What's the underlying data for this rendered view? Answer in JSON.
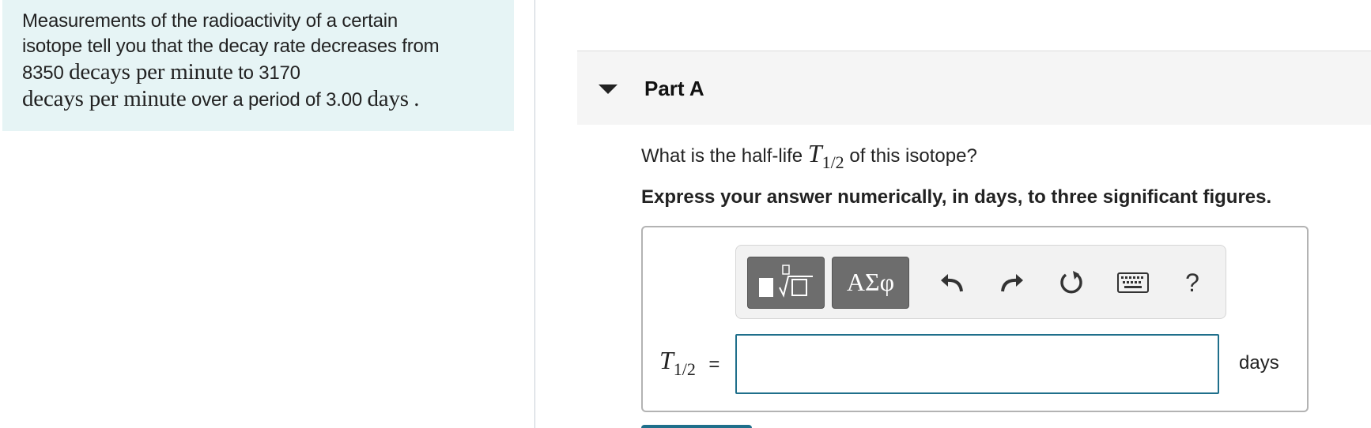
{
  "problem": {
    "line1": "Measurements of the radioactivity of a certain",
    "line2": "isotope tell you that the decay rate decreases from",
    "rate_start_value": "8350",
    "rate_units": "decays per minute",
    "connector_to": "to",
    "rate_end_value": "3170",
    "period_text": "over a period of 3.00",
    "period_units": "days",
    "end_punct": "."
  },
  "part": {
    "title": "Part A"
  },
  "question": {
    "prefix": "What is the half-life",
    "symbol": "T",
    "subscript": "1/2",
    "suffix": "of this isotope?",
    "instruction": "Express your answer numerically, in days, to three significant figures."
  },
  "toolbar": {
    "symbols_label": "ΑΣφ",
    "help_label": "?",
    "icons": [
      "templates-icon",
      "greek-symbols-icon",
      "undo-icon",
      "redo-icon",
      "reset-icon",
      "keyboard-icon",
      "help-icon"
    ]
  },
  "answer": {
    "lhs_symbol": "T",
    "lhs_subscript": "1/2",
    "equals": "=",
    "value": "",
    "units": "days"
  },
  "colors": {
    "problem_bg": "#e6f4f5",
    "input_border": "#1f6f8b",
    "tool_button": "#6d6d6d"
  }
}
